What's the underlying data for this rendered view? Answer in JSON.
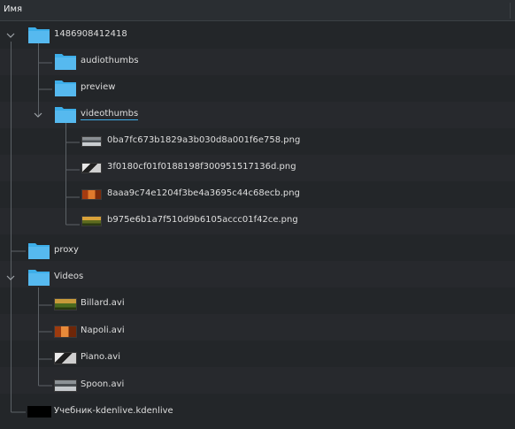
{
  "header": {
    "name_column": "Имя"
  },
  "tree": {
    "root": "1486908412418",
    "audiothumbs": "audiothumbs",
    "preview": "preview",
    "videothumbs": "videothumbs",
    "thumb_files": [
      "0ba7fc673b1829a3b030d8a001f6e758.png",
      "3f0180cf01f0188198f300951517136d.png",
      "8aaa9c74e1204f3be4a3695c44c68ecb.png",
      "b975e6b1a7f510d9b6105accc01f42ce.png"
    ],
    "proxy": "proxy",
    "videos": "Videos",
    "video_files": [
      "Billard.avi",
      "Napoli.avi",
      "Piano.avi",
      "Spoon.avi"
    ],
    "project_file": "Учебник-kdenlive.kdenlive"
  },
  "colors": {
    "background": "#232629",
    "folder": "#3daee9",
    "selection_underline": "#3daee9"
  }
}
